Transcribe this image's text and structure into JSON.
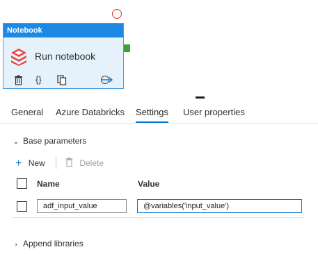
{
  "canvas": {
    "node": {
      "header_title": "Notebook",
      "title": "Run notebook",
      "icons": [
        "databricks-icon",
        "delete-icon",
        "code-braces-icon",
        "copy-icon",
        "connect-output-icon"
      ]
    }
  },
  "tabs": [
    {
      "label": "General"
    },
    {
      "label": "Azure Databricks"
    },
    {
      "label": "Settings"
    },
    {
      "label": "User properties"
    }
  ],
  "active_tab": "Settings",
  "base_parameters": {
    "label": "Base parameters",
    "toolbar": {
      "new_label": "New",
      "delete_label": "Delete"
    },
    "columns": {
      "name": "Name",
      "value": "Value"
    },
    "rows": [
      {
        "name": "adf_input_value",
        "value": "@variables('input_value')"
      }
    ]
  },
  "append_libraries": {
    "label": "Append libraries"
  },
  "colors": {
    "accent": "#0078d4",
    "node_header": "#1e88e5",
    "node_bg": "#e6f2fb",
    "success_handle": "#3f9e3f",
    "error_handle": "#d13438"
  }
}
